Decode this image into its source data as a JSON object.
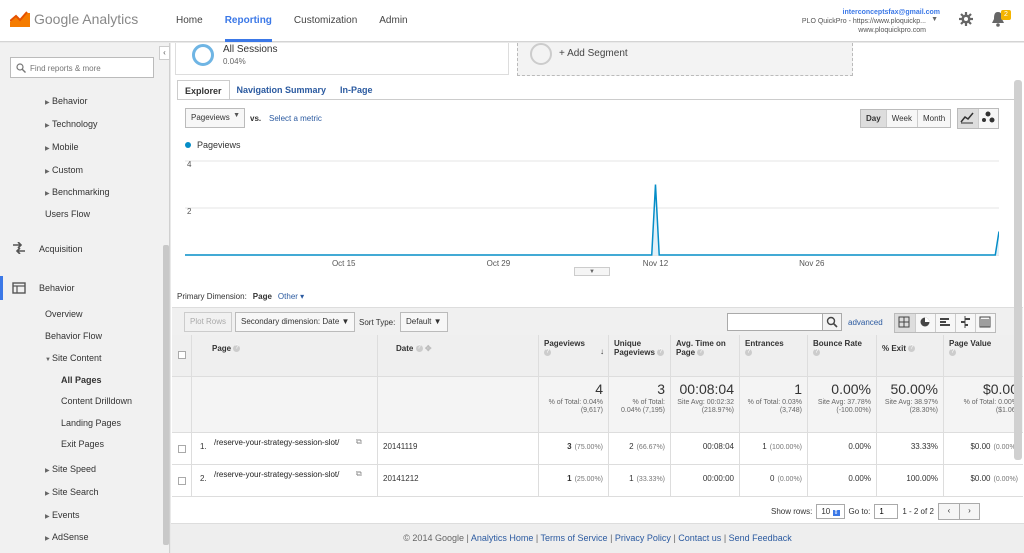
{
  "app": {
    "brand": "Google Analytics"
  },
  "topnav": [
    "Home",
    "Reporting",
    "Customization",
    "Admin"
  ],
  "account": {
    "email": "interconceptsfax@gmail.com",
    "property": "PLO QuickPro - https://www.ploquickp...",
    "url": "www.ploquickpro.com",
    "notifications": "2"
  },
  "sidebar": {
    "search_placeholder": "Find reports & more",
    "items": [
      {
        "label": "Behavior",
        "type": "sub"
      },
      {
        "label": "Technology",
        "type": "sub"
      },
      {
        "label": "Mobile",
        "type": "sub"
      },
      {
        "label": "Custom",
        "type": "sub"
      },
      {
        "label": "Benchmarking",
        "type": "sub"
      },
      {
        "label": "Users Flow",
        "type": "leaf"
      },
      {
        "label": "Acquisition",
        "type": "section"
      },
      {
        "label": "Behavior",
        "type": "section"
      },
      {
        "label": "Overview",
        "type": "leaf"
      },
      {
        "label": "Behavior Flow",
        "type": "leaf"
      },
      {
        "label": "Site Content",
        "type": "open"
      },
      {
        "label": "All Pages",
        "type": "current"
      },
      {
        "label": "Content Drilldown",
        "type": "leaf2"
      },
      {
        "label": "Landing Pages",
        "type": "leaf2"
      },
      {
        "label": "Exit Pages",
        "type": "leaf2"
      },
      {
        "label": "Site Speed",
        "type": "sub"
      },
      {
        "label": "Site Search",
        "type": "sub"
      },
      {
        "label": "Events",
        "type": "sub"
      },
      {
        "label": "AdSense",
        "type": "sub"
      }
    ]
  },
  "segments": {
    "active_name": "All Sessions",
    "active_pct": "0.04%",
    "add_label": "+ Add Segment"
  },
  "tabs": [
    "Explorer",
    "Navigation Summary",
    "In-Page"
  ],
  "controls": {
    "metric": "Pageviews",
    "vs": "vs.",
    "select_metric": "Select a metric",
    "periods": [
      "Day",
      "Week",
      "Month"
    ]
  },
  "chart_data": {
    "type": "area",
    "series": [
      {
        "name": "Pageviews",
        "color": "#058dc7",
        "values": [
          0,
          0,
          0,
          0,
          0,
          0,
          0,
          0,
          0,
          0,
          0,
          0,
          0,
          0,
          0,
          0,
          0,
          0,
          0,
          0,
          0,
          0,
          0,
          0,
          0,
          0,
          0,
          0,
          0,
          0,
          0,
          0,
          0,
          0,
          0,
          0,
          0,
          0,
          0,
          0,
          0,
          0,
          0,
          0,
          0,
          0,
          0,
          0,
          0,
          0,
          0,
          0,
          0,
          0,
          0,
          0,
          0,
          0,
          0,
          0,
          0,
          0,
          0,
          0,
          0,
          0,
          0,
          0,
          0,
          0,
          0,
          0,
          0,
          0,
          0,
          0,
          0,
          0,
          0,
          0,
          0,
          0,
          0,
          0,
          0,
          0,
          0,
          0,
          0,
          0,
          0,
          0,
          0,
          0,
          0,
          0,
          0,
          0,
          0,
          0,
          0,
          0,
          0,
          0,
          0,
          0,
          0,
          0,
          0,
          0,
          0,
          0,
          0,
          0,
          0,
          0,
          0,
          0,
          0,
          0,
          0,
          0,
          0,
          0,
          0,
          0,
          3,
          0,
          0,
          0,
          0,
          0,
          0,
          0,
          0,
          0,
          0,
          0,
          0,
          0,
          0,
          0,
          0,
          0,
          0,
          0,
          0,
          0,
          0,
          0,
          0,
          0,
          0,
          0,
          0,
          0,
          0,
          0,
          0,
          0,
          0,
          0,
          0,
          0,
          0,
          0,
          0,
          0,
          0,
          0,
          0,
          0,
          0,
          0,
          0,
          0,
          0,
          0,
          0,
          0,
          0,
          0,
          0,
          0,
          0,
          0,
          0,
          0,
          0,
          0,
          0,
          0,
          0,
          0,
          0,
          0,
          0,
          0,
          0,
          0,
          0,
          0,
          0,
          0,
          0,
          0,
          0,
          0,
          0,
          0,
          0,
          0,
          0,
          0,
          0,
          0,
          0,
          0,
          1
        ]
      }
    ],
    "x_ticks": [
      "Oct 15",
      "Oct 29",
      "Nov 12",
      "Nov 26"
    ],
    "y_ticks": [
      "4",
      "2"
    ],
    "ylim": [
      0,
      4
    ]
  },
  "table_controls": {
    "plot_rows": "Plot Rows",
    "secondary": "Secondary dimension: Date",
    "sort_label": "Sort Type:",
    "sort_value": "Default",
    "advanced": "advanced",
    "primary_label": "Primary Dimension:",
    "primary_value": "Page",
    "other": "Other"
  },
  "table": {
    "headers": [
      "Page",
      "Date",
      "Pageviews",
      "Unique Pageviews",
      "Avg. Time on Page",
      "Entrances",
      "Bounce Rate",
      "% Exit",
      "Page Value"
    ],
    "totals": [
      {
        "big": "4",
        "sub": "% of Total: 0.04% (9,617)"
      },
      {
        "big": "3",
        "sub": "% of Total: 0.04% (7,195)"
      },
      {
        "big": "00:08:04",
        "sub": "Site Avg: 00:02:32 (218.97%)"
      },
      {
        "big": "1",
        "sub": "% of Total: 0.03% (3,748)"
      },
      {
        "big": "0.00%",
        "sub": "Site Avg: 37.78% (-100.00%)"
      },
      {
        "big": "50.00%",
        "sub": "Site Avg: 38.97% (28.30%)"
      },
      {
        "big": "$0.00",
        "sub": "% of Total: 0.00% ($1.06)"
      }
    ],
    "rows": [
      {
        "n": "1.",
        "page": "/reserve-your-strategy-session-slot/",
        "date": "20141119",
        "pv": "3",
        "pvp": "(75.00%)",
        "upv": "2",
        "upvp": "(66.67%)",
        "avg": "00:08:04",
        "ent": "1",
        "entp": "(100.00%)",
        "br": "0.00%",
        "exit": "33.33%",
        "val": "$0.00",
        "valp": "(0.00%)"
      },
      {
        "n": "2.",
        "page": "/reserve-your-strategy-session-slot/",
        "date": "20141212",
        "pv": "1",
        "pvp": "(25.00%)",
        "upv": "1",
        "upvp": "(33.33%)",
        "avg": "00:00:00",
        "ent": "0",
        "entp": "(0.00%)",
        "br": "0.00%",
        "exit": "100.00%",
        "val": "$0.00",
        "valp": "(0.00%)"
      }
    ]
  },
  "pager": {
    "show_rows": "Show rows:",
    "rows_value": "10",
    "goto": "Go to:",
    "goto_value": "1",
    "range": "1 - 2 of 2"
  },
  "footer": {
    "copyright": "© 2014 Google",
    "links": [
      "Analytics Home",
      "Terms of Service",
      "Privacy Policy",
      "Contact us",
      "Send Feedback"
    ]
  }
}
